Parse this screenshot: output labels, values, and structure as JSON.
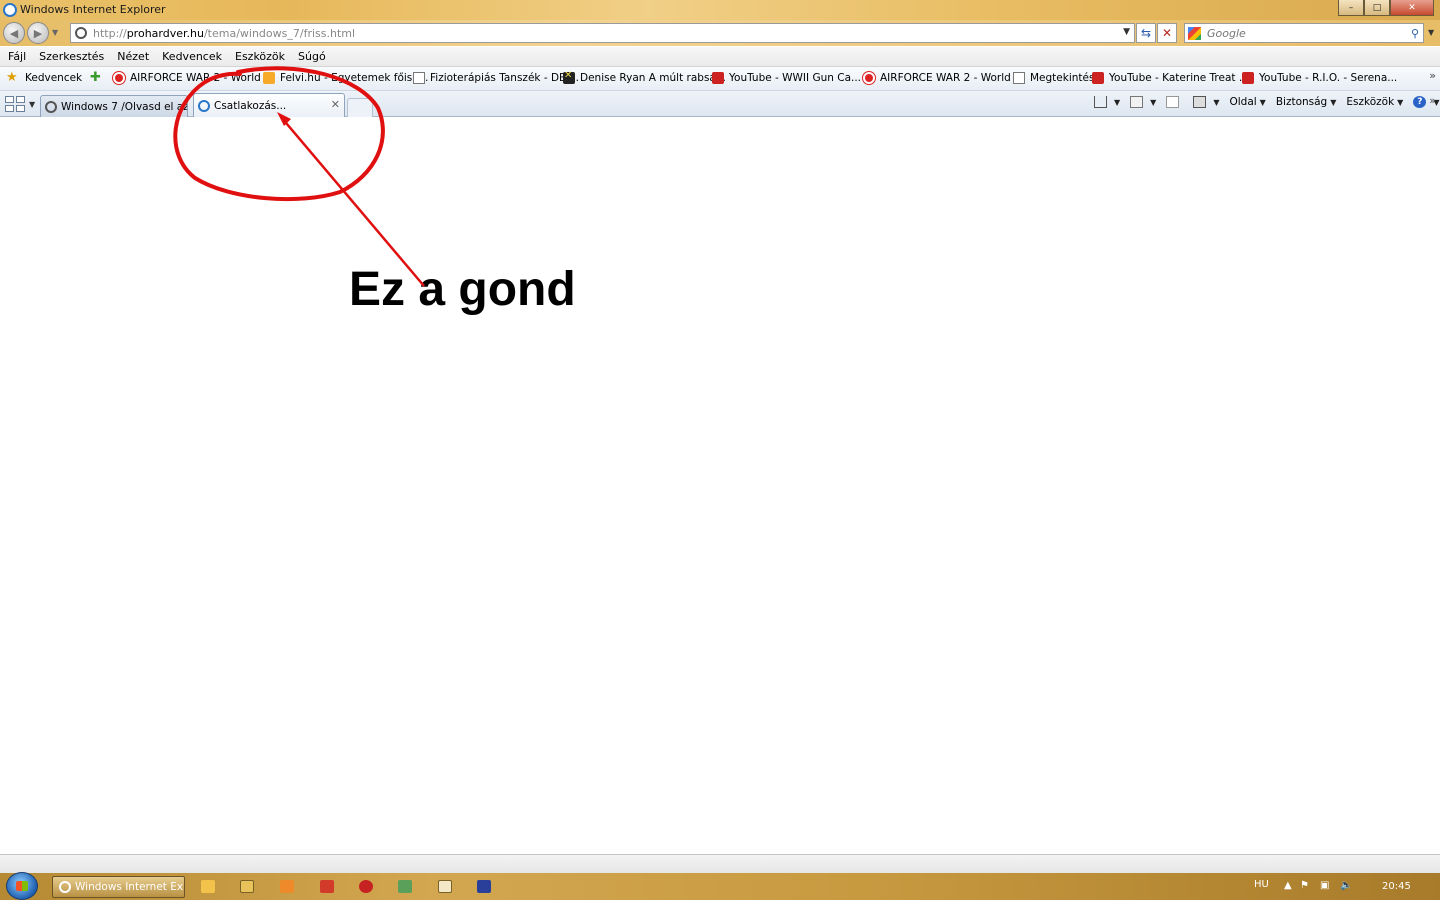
{
  "window": {
    "title": "Windows Internet Explorer",
    "buttons": {
      "minimize": "–",
      "maximize": "□",
      "close": "✕"
    }
  },
  "address_bar": {
    "url_prefix": "http://",
    "url_domain": "prohardver.hu",
    "url_path": "/tema/windows_7/friss.html",
    "search_placeholder": "Google"
  },
  "menu": {
    "items": [
      "Fájl",
      "Szerkesztés",
      "Nézet",
      "Kedvencek",
      "Eszközök",
      "Súgó"
    ]
  },
  "favorites": {
    "label": "Kedvencek",
    "items": [
      {
        "label": "AIRFORCE WAR 2 - World ...",
        "icon": "airforce-icon"
      },
      {
        "label": "Felvi.hu - Egyetemek főisk...",
        "icon": "folder-icon"
      },
      {
        "label": "Fizioterápiás Tanszék - DE ...",
        "icon": "page-icon"
      },
      {
        "label": "Denise Ryan A múlt rabsá...",
        "icon": "x-icon"
      },
      {
        "label": "YouTube - WWII Gun Ca...",
        "icon": "youtube-icon"
      },
      {
        "label": "AIRFORCE WAR 2 - World ...",
        "icon": "airforce-icon"
      },
      {
        "label": "Megtekintés",
        "icon": "page-icon"
      },
      {
        "label": "YouTube - Katerine Treat ...",
        "icon": "youtube-icon"
      },
      {
        "label": "YouTube - R.I.O. - Serena...",
        "icon": "youtube-icon"
      }
    ]
  },
  "tabs": [
    {
      "label": "Windows 7 /Olvasd el az el...",
      "active": false
    },
    {
      "label": "Csatlakozás...",
      "active": true
    }
  ],
  "command_bar": {
    "page_label": "Oldal",
    "security_label": "Biztonság",
    "tools_label": "Eszközök",
    "help_label": "?"
  },
  "annotation": {
    "text": "Ez a gond",
    "color": "#e01010"
  },
  "taskbar": {
    "active_app": "Windows Internet Ex...",
    "language": "HU",
    "clock": "20:45"
  }
}
